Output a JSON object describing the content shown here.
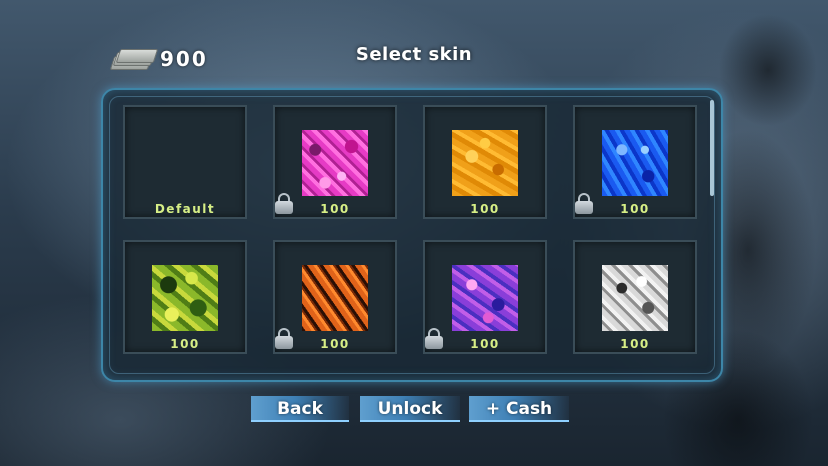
{
  "header": {
    "cash_amount": "900",
    "title": "Select skin"
  },
  "icons": {
    "currency": "money-stack-icon",
    "lock": "padlock-icon"
  },
  "skins": [
    {
      "label": "Default",
      "pattern": "none",
      "locked": false
    },
    {
      "label": "100",
      "pattern": "pink-camo",
      "locked": true
    },
    {
      "label": "100",
      "pattern": "orange-camo",
      "locked": false
    },
    {
      "label": "100",
      "pattern": "blue-camo",
      "locked": true
    },
    {
      "label": "100",
      "pattern": "green-yellow-camo",
      "locked": false
    },
    {
      "label": "100",
      "pattern": "orange-tiger",
      "locked": true
    },
    {
      "label": "100",
      "pattern": "purple-camo",
      "locked": true
    },
    {
      "label": "100",
      "pattern": "white-camo",
      "locked": false
    }
  ],
  "buttons": {
    "back": "Back",
    "unlock": "Unlock",
    "cash": "+ Cash"
  },
  "colors": {
    "price_text": "#d7ef86",
    "panel_border": "#3d86a8",
    "button": "#4a8cc0"
  }
}
